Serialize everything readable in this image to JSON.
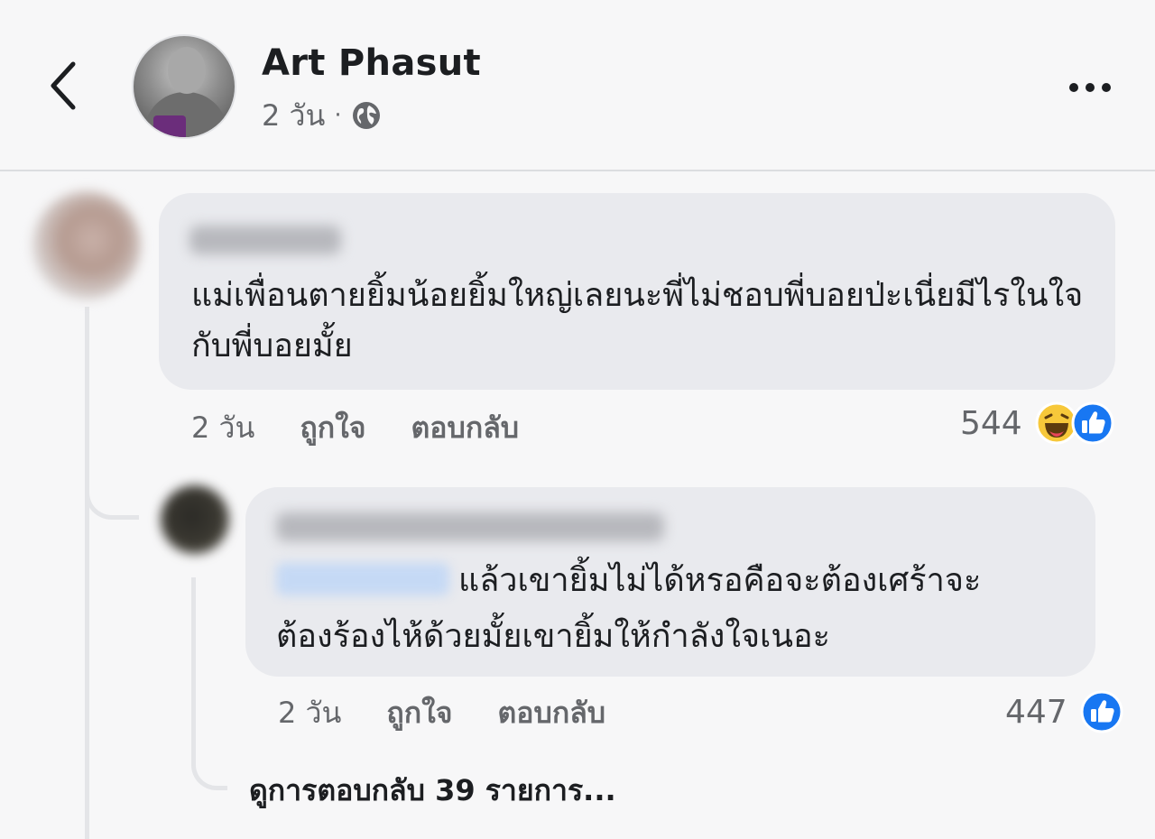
{
  "header": {
    "name": "Art Phasut",
    "time": "2 วัน",
    "separator": "·",
    "privacy_icon": "globe-icon",
    "back_icon": "chevron-left-icon",
    "more_icon": "more-horizontal-icon"
  },
  "comments": [
    {
      "text": "แม่เพื่อนตายยิ้มน้อยยิ้มใหญ่เลยนะพี่ไม่ชอบพี่บอยป่ะเนี่ยมีไรในใจกับพี่บอยมั้ย",
      "time": "2 วัน",
      "like_label": "ถูกใจ",
      "reply_label": "ตอบกลับ",
      "reaction_count": "544",
      "reactions": [
        "haha-icon",
        "like-icon"
      ]
    },
    {
      "text_line1": "แล้วเขายิ้มไม่ได้หรอคือจะต้องเศร้าจะ",
      "text_line2": "ต้องร้องไห้ด้วยมั้ยเขายิ้มให้กำลังใจเนอะ",
      "time": "2 วัน",
      "like_label": "ถูกใจ",
      "reply_label": "ตอบกลับ",
      "reaction_count": "447",
      "reactions": [
        "like-icon"
      ]
    }
  ],
  "view_replies": "ดูการตอบกลับ 39 รายการ...",
  "colors": {
    "background": "#f7f7f8",
    "bubble": "#e9eaee",
    "secondary_text": "#65676b",
    "like_blue": "#1877f2",
    "haha_yellow": "#f7c83a"
  }
}
